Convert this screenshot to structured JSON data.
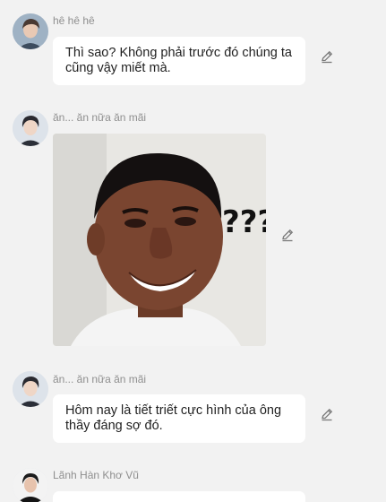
{
  "messages": [
    {
      "sender": "hê hê hê",
      "type": "text",
      "text": "Thì sao? Không phải trước đó chúng ta cũng vậy miết mà.",
      "avatar_icon": "user-avatar-icon",
      "action_icon": "pencil-icon"
    },
    {
      "sender": "ăn... ăn nữa ăn mãi",
      "type": "image",
      "image_description_icon": "confused-man-meme-image",
      "image_overlay_text": "???",
      "avatar_icon": "user-avatar-icon",
      "action_icon": "pencil-icon"
    },
    {
      "sender": "ăn... ăn nữa ăn mãi",
      "type": "text",
      "text": "Hôm nay là tiết triết cực hình của ông thầy đáng sợ đó.",
      "avatar_icon": "user-avatar-icon",
      "action_icon": "pencil-icon"
    },
    {
      "sender": "Lãnh Hàn Khơ Vũ",
      "type": "text",
      "text": "",
      "avatar_icon": "user-avatar-icon",
      "action_icon": "pencil-icon"
    }
  ],
  "colors": {
    "background": "#f2f2f2",
    "bubble": "#ffffff",
    "sender_text": "#8f8f8f",
    "icon": "#7a7a7a"
  }
}
